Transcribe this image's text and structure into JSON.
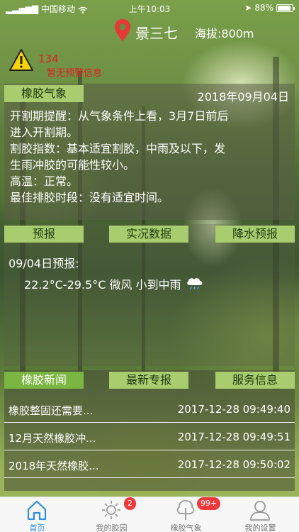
{
  "status_bar": {
    "carrier": "中国移动",
    "time": "上午10:03",
    "battery": "88%",
    "battery_level": 0.88
  },
  "location": {
    "name": "景三七",
    "altitude": "海拔:800m"
  },
  "warning": {
    "count": "134",
    "text": "暂无预警信息"
  },
  "weather_section": {
    "tab": "橡胶气象",
    "date": "2018年09月04日",
    "lines": [
      "开割期提醒：从气象条件上看，3月7日前后",
      "进入开割期。",
      "割胶指数：基本适宜割胶，中雨及以下，发",
      "生雨冲胶的可能性较小。",
      "高温：正常。",
      "最佳排胶时段：没有适宜时间。"
    ]
  },
  "forecast_section": {
    "tabs": [
      "预报",
      "实况数据",
      "降水预报"
    ],
    "title": "09/04日预报:",
    "detail": "22.2°C-29.5°C 微风 小到中雨"
  },
  "news_section": {
    "tabs": [
      "橡胶新闻",
      "最新专报",
      "服务信息"
    ],
    "items": [
      {
        "title": "橡胶整固还需要...",
        "date": "2017-12-28 09:49:40"
      },
      {
        "title": "12月天然橡胶冲...",
        "date": "2017-12-28 09:49:51"
      },
      {
        "title": "2018年天然橡胶...",
        "date": "2017-12-28 09:50:02"
      }
    ]
  },
  "tab_bar": {
    "items": [
      {
        "label": "首页",
        "icon": "home-icon"
      },
      {
        "label": "我的胶园",
        "icon": "sun-icon",
        "badge": "2"
      },
      {
        "label": "橡胶气象",
        "icon": "tree-icon",
        "badge": "99+"
      },
      {
        "label": "我的设置",
        "icon": "person-icon"
      }
    ]
  },
  "colors": {
    "accent": "#2e8ee0",
    "warning": "#e02020",
    "tab_light": "#a9cc6e",
    "tab_green": "#7bb542",
    "badge": "#f0393a"
  }
}
